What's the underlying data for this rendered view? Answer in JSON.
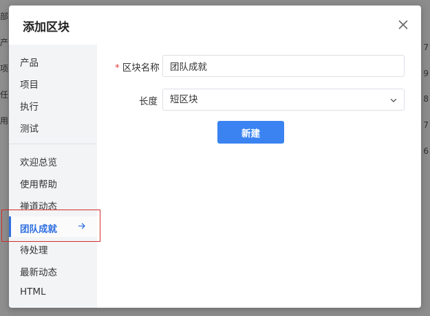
{
  "background": {
    "left_fragments": [
      "部门",
      "产",
      "项",
      "任",
      "用"
    ],
    "right_numbers": [
      "7",
      "9",
      "8",
      "7",
      "6"
    ]
  },
  "modal": {
    "title": "添加区块",
    "close_icon": "close-icon"
  },
  "sidebar": {
    "groups": [
      [
        {
          "label": "产品"
        },
        {
          "label": "项目"
        },
        {
          "label": "执行"
        },
        {
          "label": "测试"
        }
      ],
      [
        {
          "label": "欢迎总览"
        },
        {
          "label": "使用帮助"
        },
        {
          "label": "禅道动态"
        },
        {
          "label": "团队成就",
          "active": true,
          "icon": "arrow-right-icon"
        },
        {
          "label": "待处理"
        },
        {
          "label": "最新动态"
        },
        {
          "label": "HTML"
        }
      ]
    ]
  },
  "form": {
    "name_label": "区块名称",
    "required_mark": "*",
    "name_value": "团队成就",
    "length_label": "长度",
    "length_value": "短区块",
    "submit_label": "新建"
  },
  "colors": {
    "accent": "#3a83f1",
    "active_text": "#2f6fe0",
    "highlight": "#d12b2b",
    "required": "#e04040"
  }
}
